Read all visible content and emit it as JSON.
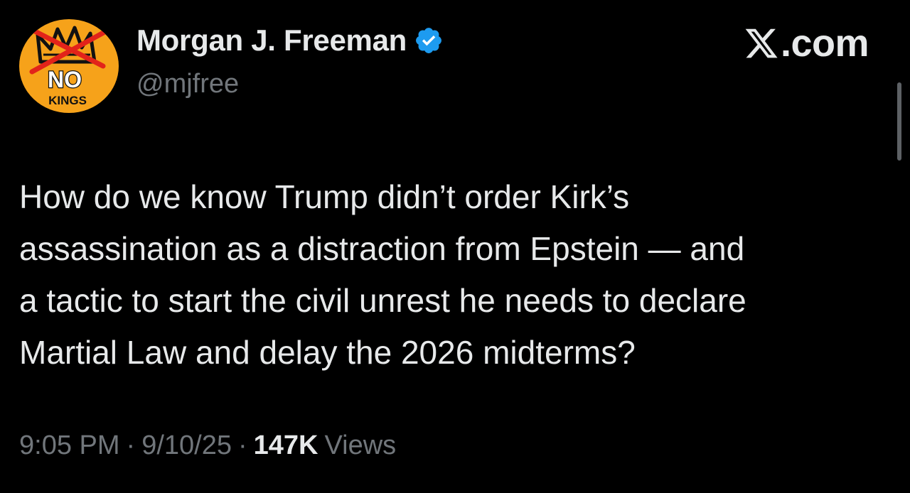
{
  "author": {
    "display_name": "Morgan J. Freeman",
    "handle": "@mjfree",
    "verified": true,
    "verified_icon": "verified-badge-icon",
    "avatar": {
      "icon": "no-kings-crown-icon",
      "text_top": "NO",
      "text_bottom": "KINGS",
      "background_color": "#f6a21a"
    }
  },
  "site": {
    "logo_icon": "x-logo-icon",
    "label": ".com"
  },
  "tweet": {
    "text": "How do we know Trump didn’t order Kirk’s\nassassination as a distraction from Epstein — and\na tactic to start the civil unrest he needs to declare\nMartial Law and delay the 2026 midterms?",
    "time": "9:05 PM",
    "date": "9/10/25",
    "separator": "·",
    "views_count": "147K",
    "views_label": "Views"
  },
  "colors": {
    "background": "#000000",
    "primary_text": "#e7e9ea",
    "secondary_text": "#71767b",
    "verified_blue": "#1d9bf0",
    "avatar_orange": "#f6a21a",
    "avatar_red": "#e2231a"
  }
}
